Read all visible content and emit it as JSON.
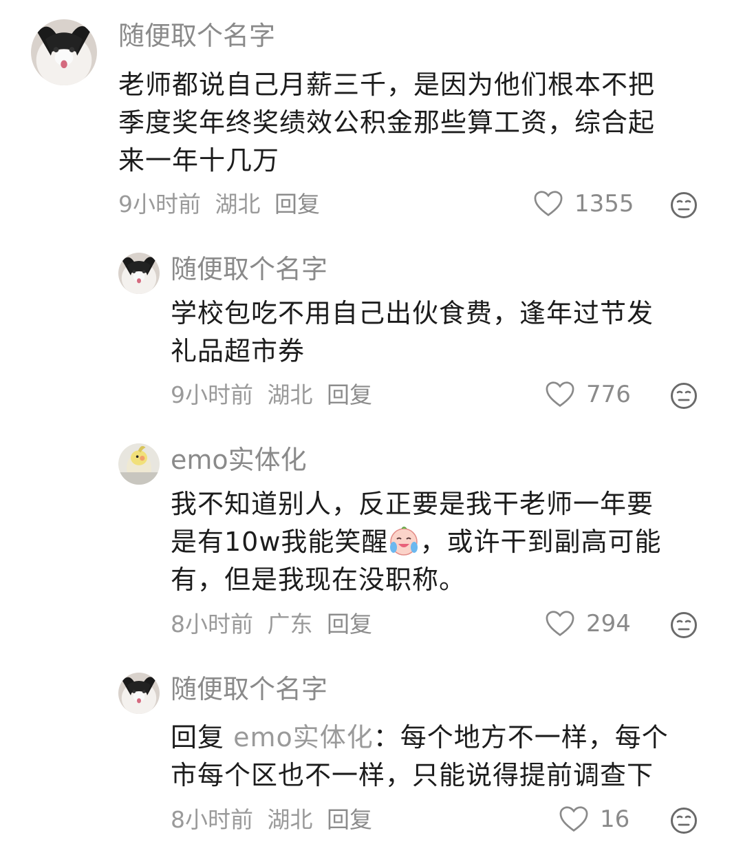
{
  "comments": [
    {
      "username": "随便取个名字",
      "lines": [
        "老师都说自己月薪三千，是因为他们根本不把",
        "季度奖年终奖绩效公积金那些算工资，综合起",
        "来一年十几万"
      ],
      "time": "9小时前",
      "location": "湖北",
      "reply_label": "回复",
      "likes": "1355",
      "avatar_icon": "cat-avatar"
    },
    {
      "username": "随便取个名字",
      "lines": [
        "学校包吃不用自己出伙食费，逢年过节发",
        "礼品超市券"
      ],
      "time": "9小时前",
      "location": "湖北",
      "reply_label": "回复",
      "likes": "776",
      "avatar_icon": "cat-avatar"
    },
    {
      "username": "emo实体化",
      "line1": "我不知道别人，反正要是我干老师一年要",
      "line2a": "是有10w我能笑醒",
      "line2b": "，或许干到副高可能",
      "line3": "有，但是我现在没职称。",
      "time": "8小时前",
      "location": "广东",
      "reply_label": "回复",
      "likes": "294",
      "avatar_icon": "bird-avatar",
      "emoji": "laughing-crying-emoji"
    },
    {
      "username": "随便取个名字",
      "reply_prefix": "回复",
      "reply_target": "emo实体化",
      "line1_rest": "：每个地方不一样，每个",
      "line2": "市每个区也不一样，只能说得提前调查下",
      "time": "8小时前",
      "location": "湖北",
      "reply_label": "回复",
      "likes": "16",
      "avatar_icon": "cat-avatar"
    }
  ],
  "icons": {
    "like": "heart-outline-icon",
    "dislike": "meh-face-icon"
  },
  "colors": {
    "text": "#1c1c1c",
    "secondary": "#8a8a8a",
    "background": "#ffffff"
  }
}
